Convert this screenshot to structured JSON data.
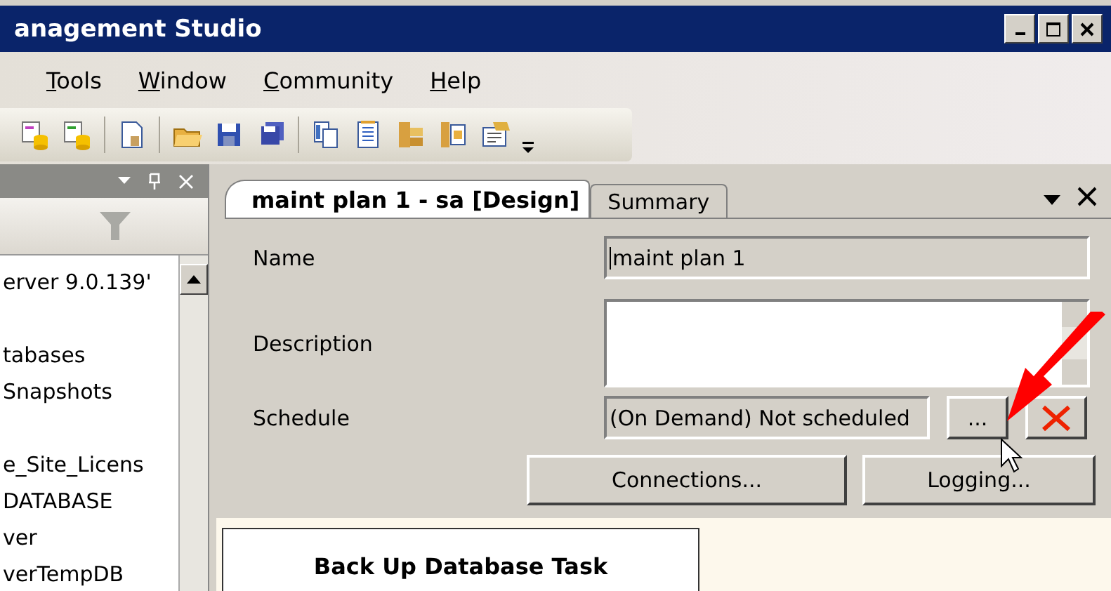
{
  "window": {
    "title": "anagement Studio"
  },
  "menu": [
    {
      "key": "T",
      "rest": "ools"
    },
    {
      "key": "W",
      "rest": "indow"
    },
    {
      "key": "C",
      "rest": "ommunity"
    },
    {
      "key": "H",
      "rest": "elp"
    }
  ],
  "explorer": {
    "groups": [
      {
        "items": [
          "erver 9.0.139'"
        ]
      },
      {
        "items": [
          "tabases",
          "Snapshots"
        ]
      },
      {
        "items": [
          "e_Site_Licens",
          "DATABASE",
          "ver",
          "verTempDB"
        ]
      }
    ]
  },
  "tabs": [
    {
      "label": "maint plan 1 - sa [Design]",
      "selected": true
    },
    {
      "label": "Summary",
      "selected": false
    }
  ],
  "form": {
    "name_label": "Name",
    "name_value": "maint plan 1",
    "description_label": "Description",
    "schedule_label": "Schedule",
    "schedule_value": "(On Demand) Not scheduled",
    "browse_button": "...",
    "connections_button": "Connections...",
    "logging_button": "Logging..."
  },
  "design_surface": {
    "tasks": [
      {
        "title": "Back Up Database Task"
      }
    ]
  }
}
